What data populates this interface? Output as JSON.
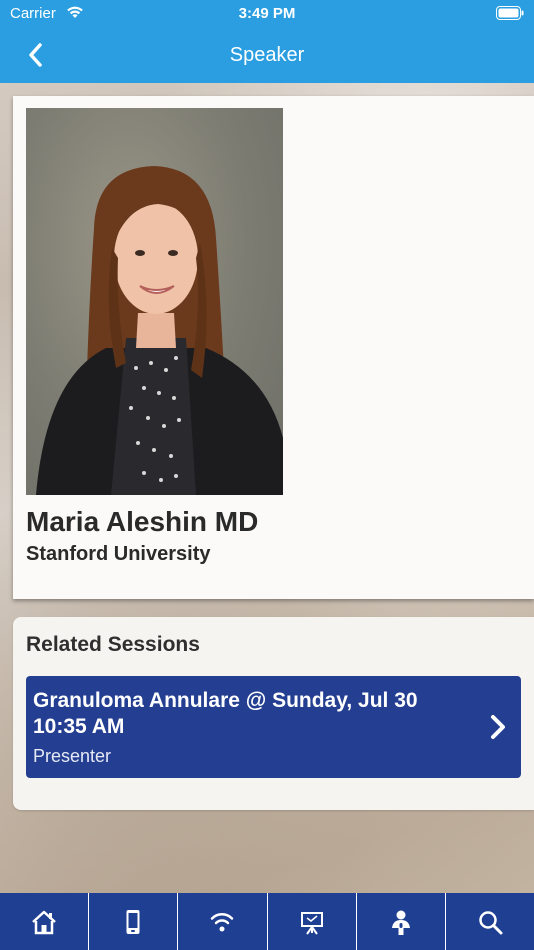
{
  "status_bar": {
    "carrier": "Carrier",
    "time": "3:49 PM"
  },
  "nav": {
    "title": "Speaker",
    "back_icon": "chevron-left-icon"
  },
  "speaker": {
    "name": "Maria Aleshin MD",
    "organization": "Stanford University",
    "photo": "speaker-photo"
  },
  "related": {
    "title": "Related Sessions",
    "sessions": [
      {
        "title": "Granuloma Annulare @ Sunday, Jul 30 10:35 AM",
        "role": "Presenter"
      }
    ]
  },
  "tabbar": {
    "icons": [
      "home-icon",
      "mobile-icon",
      "wifi-icon",
      "presentation-icon",
      "speaker-icon",
      "search-icon"
    ]
  },
  "colors": {
    "nav_bar": "#2a9ee0",
    "session_item": "#243f91",
    "tab_bar": "#1f3f92"
  }
}
